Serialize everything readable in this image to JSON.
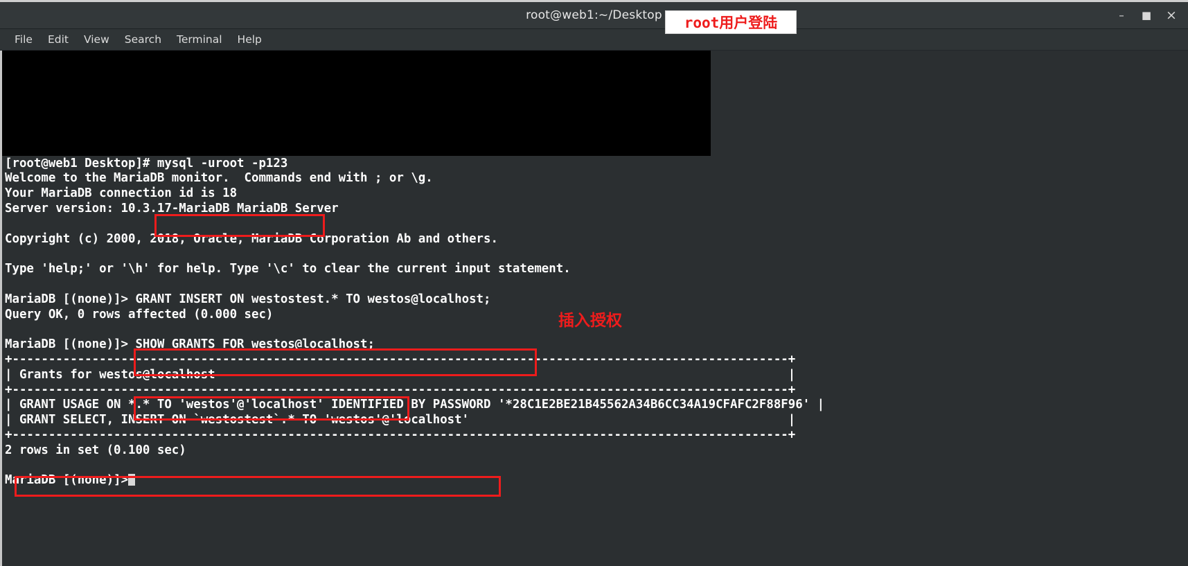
{
  "window": {
    "title": "root@web1:~/Desktop",
    "controls": [
      {
        "name": "minimize",
        "glyph": "–"
      },
      {
        "name": "maximize",
        "glyph": "■"
      },
      {
        "name": "close",
        "glyph": "×"
      }
    ]
  },
  "menubar": {
    "items": [
      {
        "label": "File"
      },
      {
        "label": "Edit"
      },
      {
        "label": "View"
      },
      {
        "label": "Search"
      },
      {
        "label": "Terminal"
      },
      {
        "label": "Help"
      }
    ]
  },
  "terminal": {
    "lines": [
      "",
      "",
      "",
      "",
      "",
      "",
      "",
      "[root@web1 Desktop]# mysql -uroot -p123",
      "Welcome to the MariaDB monitor.  Commands end with ; or \\g.",
      "Your MariaDB connection id is 18",
      "Server version: 10.3.17-MariaDB MariaDB Server",
      "",
      "Copyright (c) 2000, 2018, Oracle, MariaDB Corporation Ab and others.",
      "",
      "Type 'help;' or '\\h' for help. Type '\\c' to clear the current input statement.",
      "",
      "MariaDB [(none)]> GRANT INSERT ON westostest.* TO westos@localhost;",
      "Query OK, 0 rows affected (0.000 sec)",
      "",
      "MariaDB [(none)]> SHOW GRANTS FOR westos@localhost;",
      "+-----------------------------------------------------------------------------------------------------------+",
      "| Grants for westos@localhost                                                                               |",
      "+-----------------------------------------------------------------------------------------------------------+",
      "| GRANT USAGE ON *.* TO 'westos'@'localhost' IDENTIFIED BY PASSWORD '*28C1E2BE21B45562A34B6CC34A19CFAFC2F88F96' |",
      "| GRANT SELECT, INSERT ON `westostest`.* TO 'westos'@'localhost'                                            |",
      "+-----------------------------------------------------------------------------------------------------------+",
      "2 rows in set (0.100 sec)",
      "",
      "MariaDB [(none)]>"
    ],
    "prompt_user": "root",
    "prompt_host": "web1",
    "prompt_cwd": "Desktop",
    "command_1": "mysql -uroot -p123",
    "command_2": "GRANT INSERT ON westostest.* TO westos@localhost;",
    "command_3": "SHOW GRANTS FOR westos@localhost;",
    "grant_row_highlighted": "GRANT SELECT, INSERT ON `westostest`.* TO 'westos'@'localhost'",
    "server_version": "10.3.17-MariaDB MariaDB Server",
    "connection_id": "18",
    "rows_in_set": "2 rows in set (0.100 sec)",
    "query_ok": "Query OK, 0 rows affected (0.000 sec)",
    "password_hash": "*28C1E2BE21B45562A34B6CC34A19CFAFC2F88F96"
  },
  "annotations": {
    "root_login": "root用户登陆",
    "insert_grant": "插入授权",
    "color": "#ee1c1c"
  }
}
